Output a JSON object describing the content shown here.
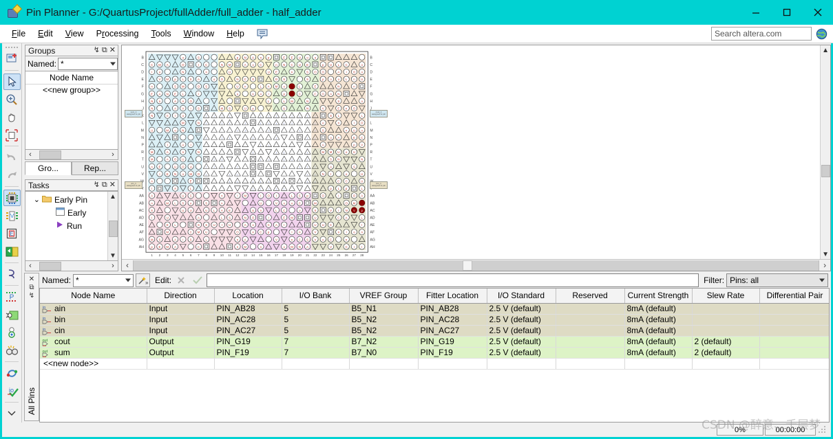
{
  "window": {
    "title": "Pin Planner - G:/QuartusProject/fullAdder/full_adder - half_adder",
    "icon": "pin-planner-icon",
    "minimize_label": "—",
    "maximize_label": "☐",
    "close_label": "✕",
    "titlebar_color": "#00d2d2"
  },
  "menubar": {
    "items": [
      {
        "label": "File",
        "mnemonic": "F"
      },
      {
        "label": "Edit",
        "mnemonic": "E"
      },
      {
        "label": "View",
        "mnemonic": "V"
      },
      {
        "label": "Processing",
        "mnemonic": "P"
      },
      {
        "label": "Tools",
        "mnemonic": "T"
      },
      {
        "label": "Window",
        "mnemonic": "W"
      },
      {
        "label": "Help",
        "mnemonic": "H"
      }
    ],
    "bubble_icon": "speech-bubble-icon",
    "search": {
      "placeholder": "Search altera.com",
      "value": "",
      "globe_icon": "globe-icon"
    }
  },
  "left_toolbar": {
    "buttons": [
      {
        "name": "new-pin-planner-icon",
        "selected": false
      },
      {
        "name": "selection-arrow-icon",
        "selected": true
      },
      {
        "name": "zoom-icon",
        "selected": false
      },
      {
        "name": "hand-pan-icon",
        "selected": false
      },
      {
        "name": "fit-in-window-icon",
        "selected": false
      },
      {
        "name": "undo-icon",
        "selected": false
      },
      {
        "name": "redo-icon",
        "selected": false
      },
      {
        "name": "package-top-view-icon",
        "selected": true
      },
      {
        "name": "pad-view-icon",
        "selected": false
      },
      {
        "name": "interior-cells-icon",
        "selected": false
      },
      {
        "name": "resource-icon",
        "selected": false
      },
      {
        "name": "io-bank-icon",
        "selected": false
      },
      {
        "name": "pin-legend-icon",
        "selected": false
      },
      {
        "name": "pin-migration-icon",
        "selected": false
      },
      {
        "name": "live-io-check-icon",
        "selected": false
      },
      {
        "name": "info-icon",
        "selected": false
      },
      {
        "name": "find-icon",
        "selected": false
      },
      {
        "name": "refresh-icon",
        "selected": false
      },
      {
        "name": "io-validate-icon",
        "selected": false
      },
      {
        "name": "more-chevron-icon",
        "selected": false
      }
    ]
  },
  "groups_panel": {
    "title": "Groups",
    "pin_label": "↯",
    "float_label": "⧉",
    "close_label": "✕",
    "named_label": "Named:",
    "named_value": "*",
    "column_header": "Node Name",
    "rows": [
      "<<new group>>"
    ],
    "tabs": [
      {
        "label": "Gro...",
        "active": true
      },
      {
        "label": "Rep...",
        "active": false
      }
    ]
  },
  "tasks_panel": {
    "title": "Tasks",
    "pin_label": "↯",
    "float_label": "⧉",
    "close_label": "✕",
    "items": [
      {
        "label": "Early Pin",
        "icon": "folder-icon",
        "expander": "⌄",
        "indent": 0
      },
      {
        "label": "Early",
        "icon": "report-icon",
        "expander": "",
        "indent": 1
      },
      {
        "label": "Run",
        "icon": "run-play-icon",
        "expander": "",
        "indent": 1
      }
    ]
  },
  "chip_view": {
    "name": "device-package-view",
    "row_labels": [
      "B",
      "C",
      "D",
      "E",
      "F",
      "G",
      "H",
      "J",
      "K",
      "L",
      "M",
      "N",
      "P",
      "R",
      "T",
      "U",
      "V",
      "W",
      "Y",
      "AA",
      "AB",
      "AC",
      "AD",
      "AE",
      "AF",
      "AG",
      "AH"
    ],
    "col_labels": [
      "1",
      "2",
      "3",
      "4",
      "5",
      "6",
      "7",
      "8",
      "9",
      "10",
      "11",
      "12",
      "13",
      "14",
      "15",
      "16",
      "17",
      "18",
      "19",
      "20",
      "21",
      "22",
      "23",
      "24",
      "25",
      "26",
      "27",
      "28"
    ],
    "callouts": [
      {
        "text": "sum_1\\nassigned to pin",
        "side": "left",
        "row": 10
      },
      {
        "text": "cout_1\\nassigned to pin",
        "side": "right",
        "row": 10
      },
      {
        "text": "ain_1\\nassigned to pin",
        "side": "left",
        "row": 21
      },
      {
        "text": "bin_1\\nassigned to pin",
        "side": "right",
        "row": 21
      }
    ],
    "highlight_color": "#8b0000"
  },
  "pin_table": {
    "all_pins_label": "All Pins",
    "strip_buttons": [
      "✕",
      "⧉",
      "↯"
    ],
    "named_label": "Named:",
    "named_value": "*",
    "wand_icon": "wand-icon",
    "edit_label": "Edit:",
    "edit_cancel_icon": "cancel-x-icon",
    "edit_accept_icon": "accept-check-icon",
    "edit_value": "",
    "filter_label": "Filter:",
    "filter_value": "Pins: all",
    "columns": [
      "Node Name",
      "Direction",
      "Location",
      "I/O Bank",
      "VREF Group",
      "Fitter Location",
      "I/O Standard",
      "Reserved",
      "Current Strength",
      "Slew Rate",
      "Differential Pair"
    ],
    "rows": [
      {
        "kind": "input",
        "icon": "input-pin-icon",
        "cells": [
          "ain",
          "Input",
          "PIN_AB28",
          "5",
          "B5_N1",
          "PIN_AB28",
          "2.5 V (default)",
          "",
          "8mA (default)",
          "",
          ""
        ]
      },
      {
        "kind": "input",
        "icon": "input-pin-icon",
        "cells": [
          "bin",
          "Input",
          "PIN_AC28",
          "5",
          "B5_N2",
          "PIN_AC28",
          "2.5 V (default)",
          "",
          "8mA (default)",
          "",
          ""
        ]
      },
      {
        "kind": "input",
        "icon": "input-pin-icon",
        "cells": [
          "cin",
          "Input",
          "PIN_AC27",
          "5",
          "B5_N2",
          "PIN_AC27",
          "2.5 V (default)",
          "",
          "8mA (default)",
          "",
          ""
        ]
      },
      {
        "kind": "output",
        "icon": "output-pin-icon",
        "cells": [
          "cout",
          "Output",
          "PIN_G19",
          "7",
          "B7_N2",
          "PIN_G19",
          "2.5 V (default)",
          "",
          "8mA (default)",
          "2 (default)",
          ""
        ]
      },
      {
        "kind": "output",
        "icon": "output-pin-icon",
        "cells": [
          "sum",
          "Output",
          "PIN_F19",
          "7",
          "B7_N0",
          "PIN_F19",
          "2.5 V (default)",
          "",
          "8mA (default)",
          "2 (default)",
          ""
        ]
      },
      {
        "kind": "new",
        "icon": "",
        "cells": [
          "<<new node>>",
          "",
          "",
          "",
          "",
          "",
          "",
          "",
          "",
          "",
          ""
        ]
      }
    ]
  },
  "status_bar": {
    "progress": "0%",
    "time": "00:00:00",
    "resize_grip": "resize-grip-icon"
  },
  "watermark": {
    "text": "CSDN @醉意、千层梦"
  }
}
